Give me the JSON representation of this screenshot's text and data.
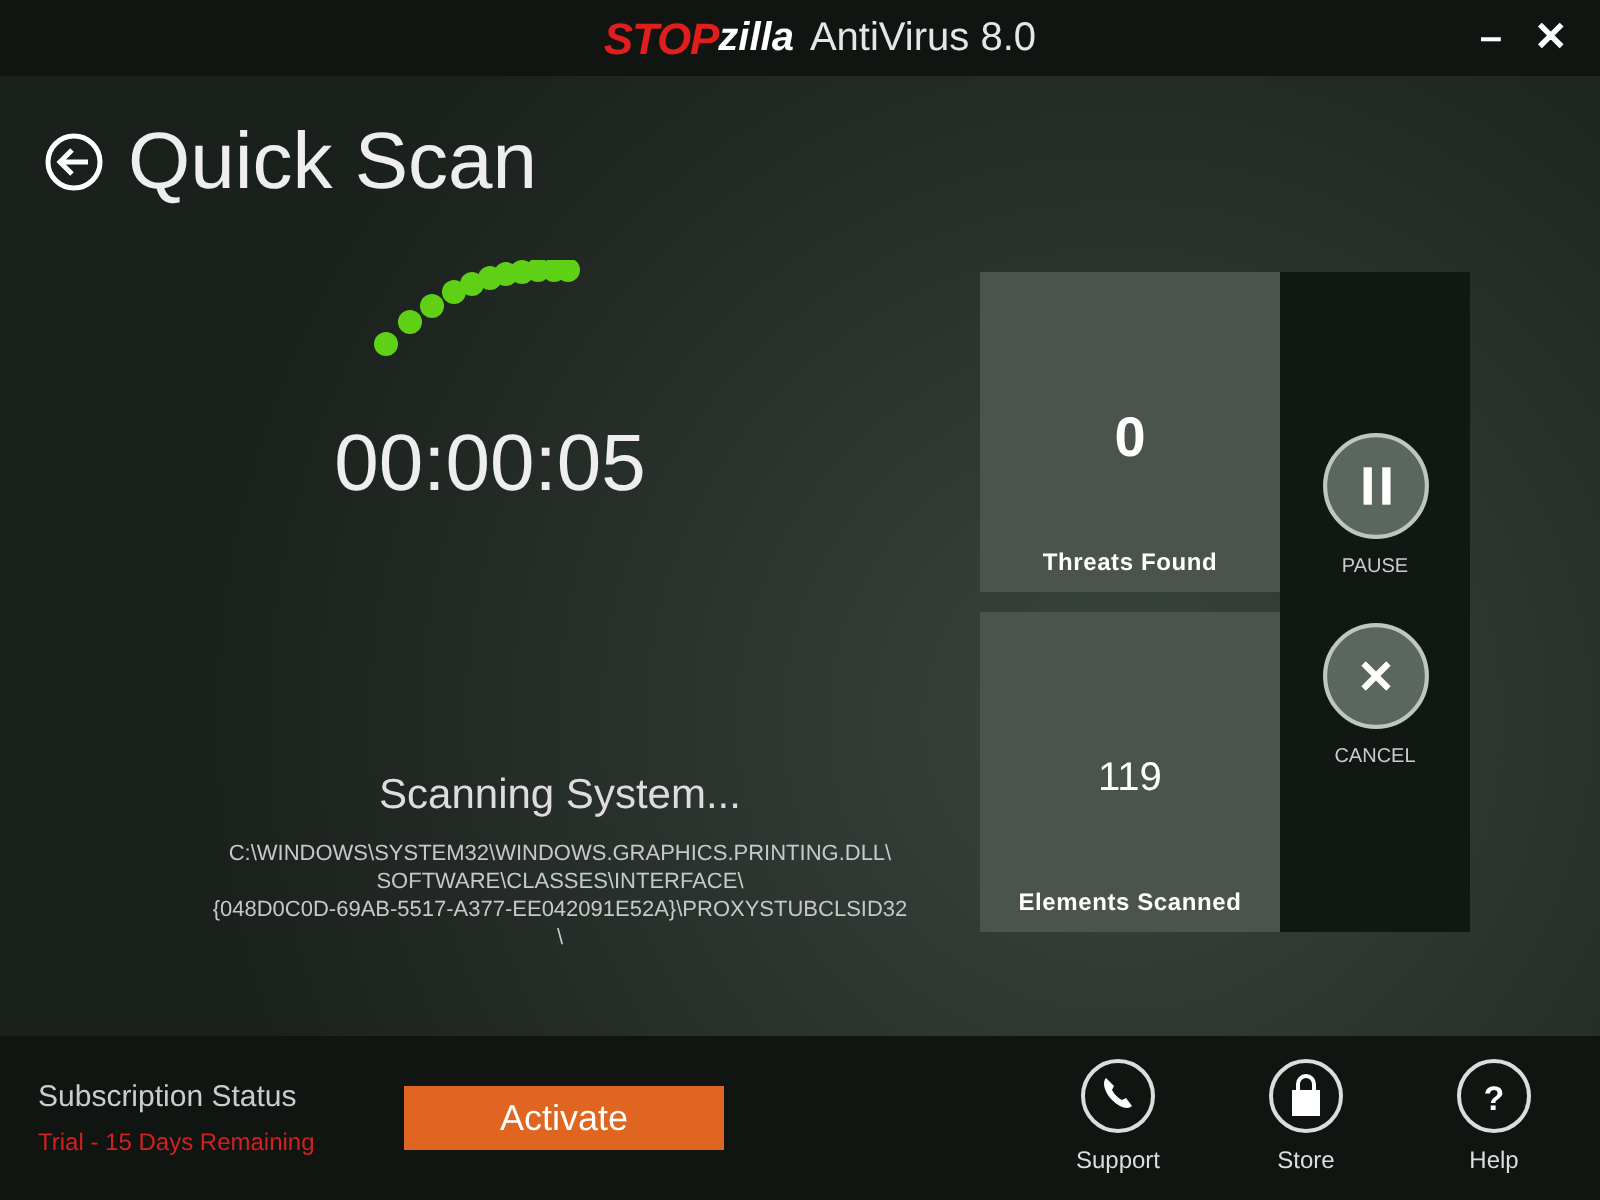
{
  "window": {
    "logo_part_1": "STOP",
    "logo_part_2": "zilla",
    "title": "AntiVirus 8.0",
    "controls": [
      "–",
      "✕"
    ]
  },
  "heading": "Quick Scan",
  "scan": {
    "elapsed": "00:00:05",
    "status": "Scanning System...",
    "path_lines": [
      "C:\\WINDOWS\\SYSTEM32\\WINDOWS.GRAPHICS.PRINTING.DLL\\",
      "SOFTWARE\\CLASSES\\INTERFACE\\",
      "{048D0C0D-69AB-5517-A377-EE042091E52A}\\PROXYSTUBCLSID32",
      "\\"
    ]
  },
  "stats": [
    {
      "kind": "threats",
      "value": "0",
      "label": "Threats Found"
    },
    {
      "kind": "elements",
      "value": "119",
      "label": "Elements Scanned"
    }
  ],
  "actions": [
    {
      "kind": "pause",
      "label": "PAUSE"
    },
    {
      "kind": "cancel",
      "label": "CANCEL"
    }
  ],
  "footer": {
    "subscription_title": "Subscription Status",
    "subscription_detail": "Trial - 15 Days Remaining",
    "activate": "Activate",
    "links": [
      {
        "kind": "support",
        "label": "Support"
      },
      {
        "kind": "store",
        "label": "Store"
      },
      {
        "kind": "help",
        "label": "Help",
        "glyph": "?"
      }
    ]
  }
}
